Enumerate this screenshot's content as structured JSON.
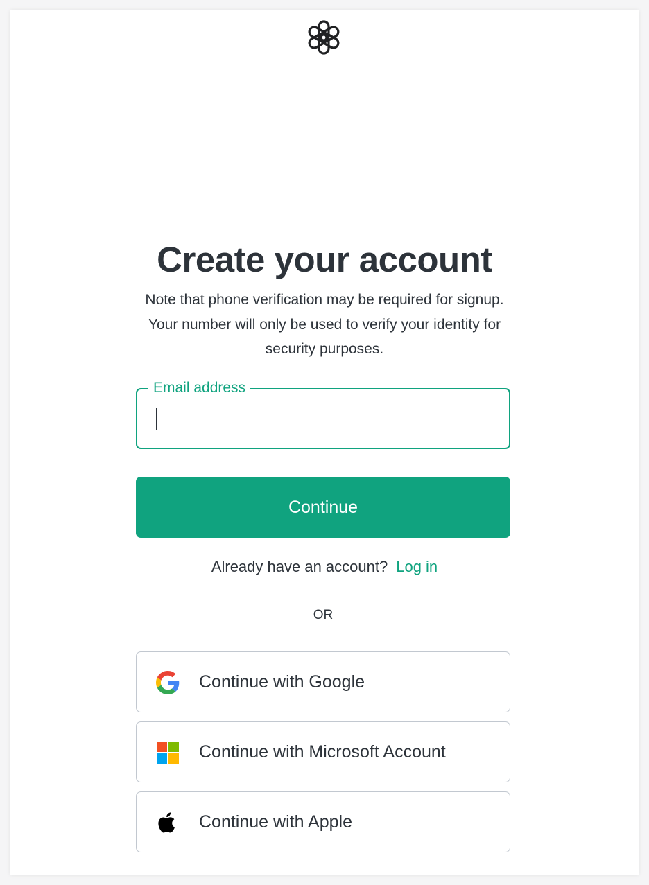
{
  "logo": {
    "icon": "openai-logo-icon"
  },
  "heading": "Create your account",
  "subtitle": "Note that phone verification may be required for signup. Your number will only be used to verify your identity for security purposes.",
  "email": {
    "label": "Email address",
    "value": ""
  },
  "continue_label": "Continue",
  "login": {
    "prompt": "Already have an account?",
    "link": "Log in"
  },
  "divider_text": "OR",
  "social": {
    "google": {
      "label": "Continue with Google",
      "icon": "google-icon"
    },
    "microsoft": {
      "label": "Continue with Microsoft Account",
      "icon": "microsoft-icon"
    },
    "apple": {
      "label": "Continue with Apple",
      "icon": "apple-icon"
    }
  },
  "colors": {
    "accent": "#10a37f",
    "text": "#2d333a",
    "border": "#c2c8d0"
  }
}
